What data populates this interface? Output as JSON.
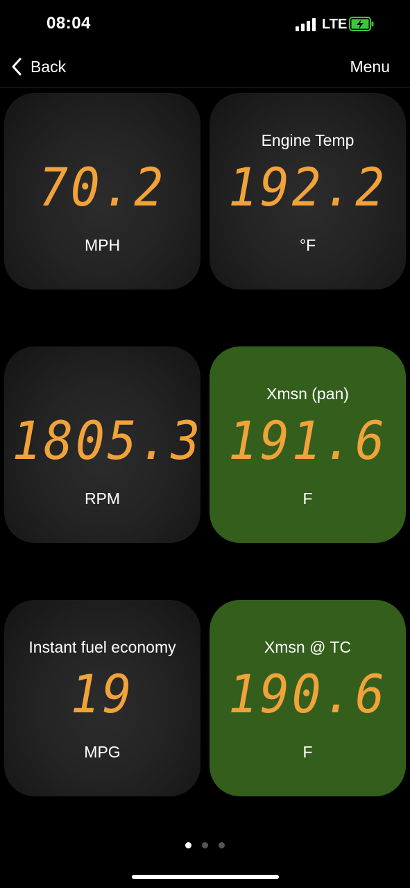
{
  "status_bar": {
    "time": "08:04",
    "network": "LTE",
    "battery_color": "#3ec53e"
  },
  "nav": {
    "back_label": "Back",
    "menu_label": "Menu"
  },
  "tiles": [
    {
      "title": "",
      "value": "70.2",
      "unit": "MPH",
      "highlight": false
    },
    {
      "title": "Engine Temp",
      "value": "192.2",
      "unit": "°F",
      "highlight": false
    },
    {
      "title": "",
      "value": "1805.3",
      "unit": "RPM",
      "highlight": false
    },
    {
      "title": "Xmsn (pan)",
      "value": "191.6",
      "unit": "F",
      "highlight": true
    },
    {
      "title": "Instant fuel economy",
      "value": "19",
      "unit": "MPG",
      "highlight": false
    },
    {
      "title": "Xmsn @ TC",
      "value": "190.6",
      "unit": "F",
      "highlight": true
    }
  ],
  "pager": {
    "pages": 3,
    "current": 1
  },
  "colors": {
    "digit": "#f1a33a",
    "highlight_tile": "#345e1c",
    "tile_dark": "#242424"
  }
}
